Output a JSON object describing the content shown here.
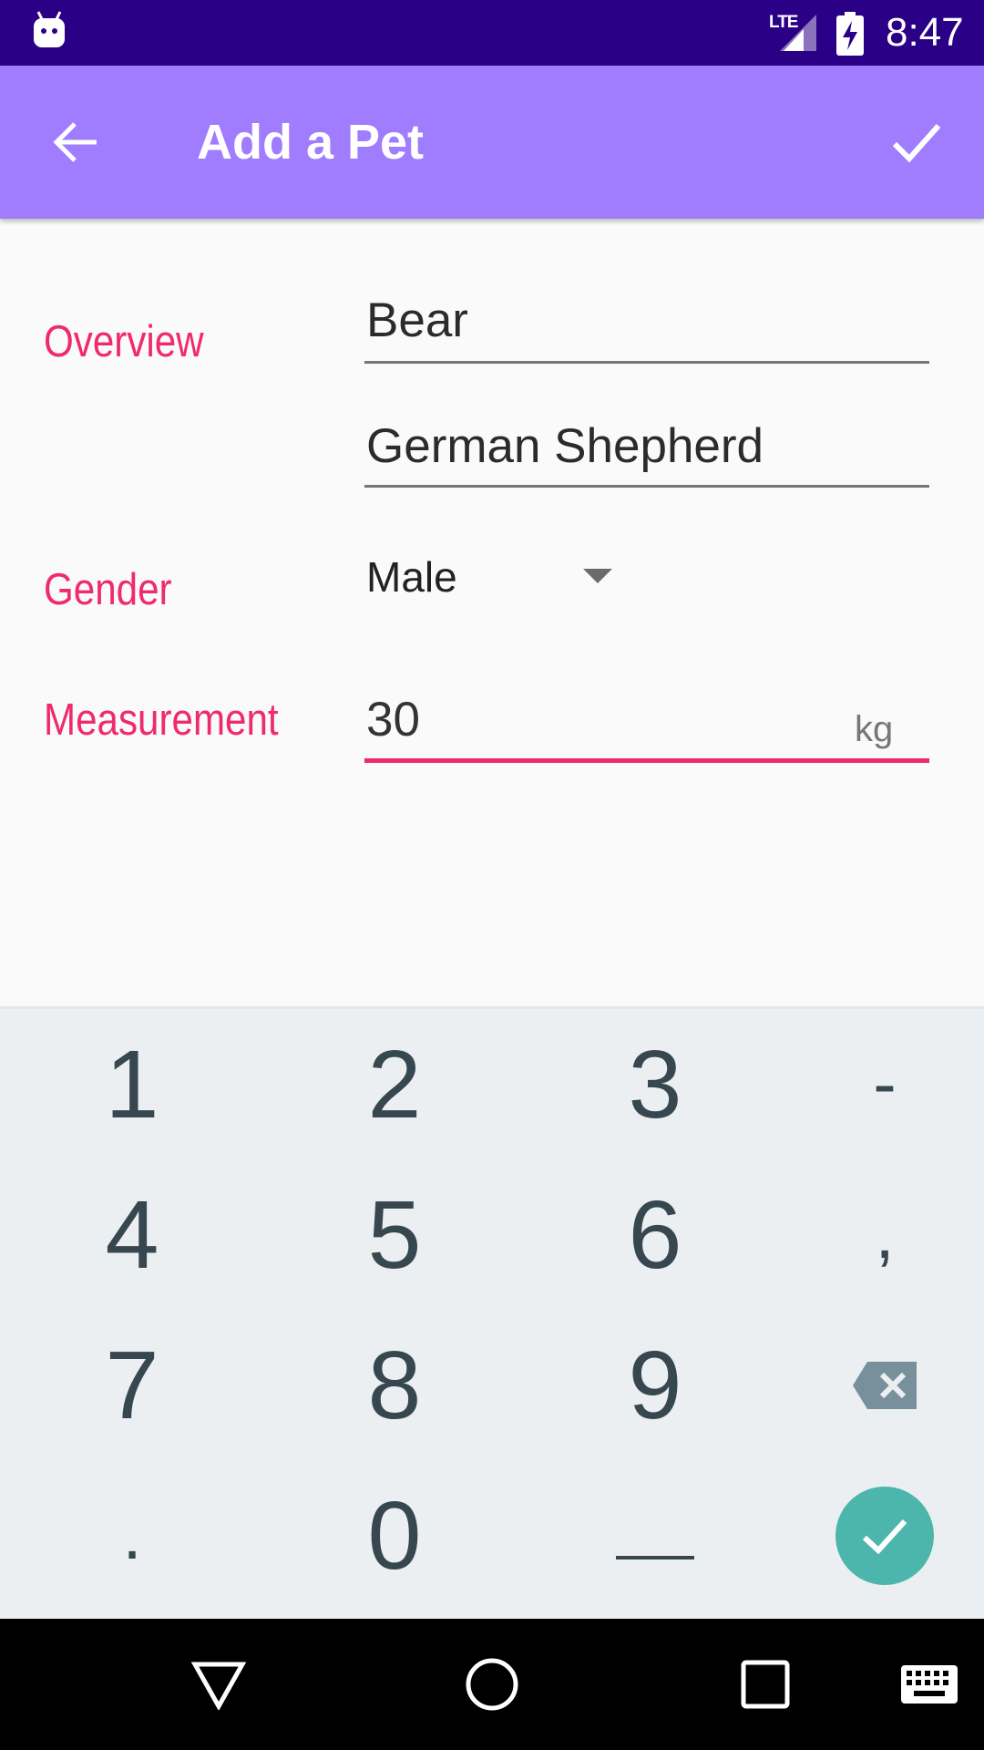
{
  "status_bar": {
    "network": "LTE",
    "time": "8:47"
  },
  "app_bar": {
    "title": "Add a Pet",
    "back_icon": "arrow-back-icon",
    "save_icon": "check-icon"
  },
  "form": {
    "overview_label": "Overview",
    "name_value": "Bear",
    "breed_value": "German Shepherd",
    "gender_label": "Gender",
    "gender_selected": "Male",
    "measurement_label": "Measurement",
    "weight_value": "30",
    "weight_unit": "kg"
  },
  "keyboard": {
    "keys": [
      "1",
      "2",
      "3",
      "-",
      "4",
      "5",
      "6",
      ",",
      "7",
      "8",
      "9",
      "backspace",
      ".",
      "0",
      "space",
      "enter"
    ],
    "labels": {
      "k1": "1",
      "k2": "2",
      "k3": "3",
      "dash": "-",
      "k4": "4",
      "k5": "5",
      "k6": "6",
      "comma": ",",
      "k7": "7",
      "k8": "8",
      "k9": "9",
      "dot": ".",
      "k0": "0"
    },
    "enter_color": "#4db6ac"
  },
  "colors": {
    "status_bar": "#2a0086",
    "app_bar": "#a07cff",
    "accent": "#ef2a6d",
    "keyboard_bg": "#eceff1",
    "key_text": "#37474f"
  },
  "nav_bar": {
    "icons": [
      "back-triangle-icon",
      "home-circle-icon",
      "recents-square-icon",
      "keyboard-icon"
    ]
  }
}
